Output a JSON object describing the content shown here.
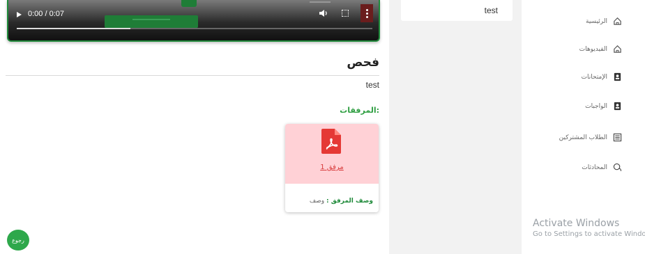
{
  "video": {
    "time": "0:00 / 0:07",
    "progress_pct": 32
  },
  "lesson": {
    "title": "فحص",
    "description": "test",
    "attachments_label": "المرفقات:"
  },
  "attachment": {
    "link_label": "مرفق 1",
    "desc_key": "وصف المرفق :",
    "desc_value": "وصف"
  },
  "back_label": "رجوع",
  "side_card": {
    "text": "test"
  },
  "sidebar": {
    "items": [
      {
        "label": "الرئيسية",
        "icon": "home-icon"
      },
      {
        "label": "الفيديوهات",
        "icon": "home-icon"
      },
      {
        "label": "الإمتحانات",
        "icon": "badge-icon"
      },
      {
        "label": "الواجبات",
        "icon": "badge-icon"
      },
      {
        "label": "الطلاب المشتركين",
        "icon": "list-icon"
      },
      {
        "label": "المحادثات",
        "icon": "chat-icon"
      }
    ]
  },
  "watermark": {
    "line1": "Activate Windows",
    "line2": "Go to Settings to activate Window"
  },
  "colors": {
    "accent_green": "#2ea84b",
    "pdf_red": "#e53935",
    "card_pink": "#ffd1d6"
  }
}
